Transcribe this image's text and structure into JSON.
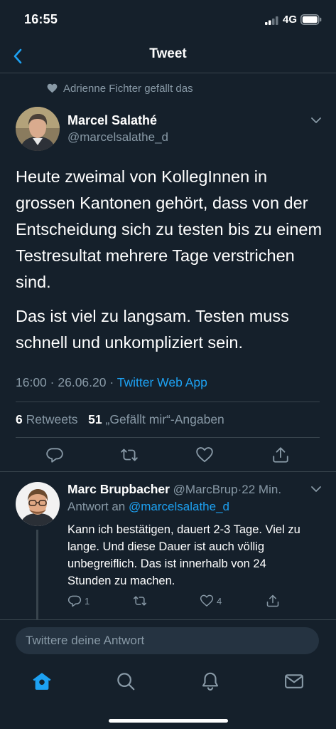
{
  "status_bar": {
    "time": "16:55",
    "network": "4G"
  },
  "nav": {
    "title": "Tweet"
  },
  "liked_by": {
    "text": "Adrienne Fichter gefällt das"
  },
  "tweet": {
    "author_name": "Marcel Salathé",
    "author_handle": "@marcelsalathe_d",
    "paragraphs": [
      "Heute zweimal von KollegInnen in grossen Kantonen gehört, dass von der Entscheidung sich zu testen bis zu einem Testresultat mehrere Tage verstrichen sind.",
      "Das ist viel zu langsam. Testen muss schnell und unkompliziert sein."
    ],
    "time": "16:00",
    "separator": "·",
    "date": "26.06.20",
    "source": "Twitter Web App",
    "retweets_count": "6",
    "retweets_label": "Retweets",
    "likes_count": "51",
    "likes_label": "„Gefällt mir“-Angaben"
  },
  "reply": {
    "author_name": "Marc Brupbacher",
    "author_handle": "@MarcBrup",
    "separator": "·",
    "time_ago": "22 Min.",
    "reply_to_label": "Antwort an",
    "reply_to_handle": "@marcelsalathe_d",
    "text": "Kann ich bestätigen, dauert 2-3 Tage. Viel zu lange. Und diese Dauer ist auch völlig unbegreiflich. Das ist innerhalb von 24 Stunden zu machen.",
    "reply_count": "1",
    "like_count": "4"
  },
  "compose": {
    "placeholder": "Twittere deine Antwort"
  },
  "colors": {
    "background": "#15202b",
    "accent": "#1da1f2",
    "muted": "#8899a6",
    "divider": "#38444d"
  },
  "tabs": [
    "home-icon",
    "search-icon",
    "bell-icon",
    "mail-icon"
  ]
}
